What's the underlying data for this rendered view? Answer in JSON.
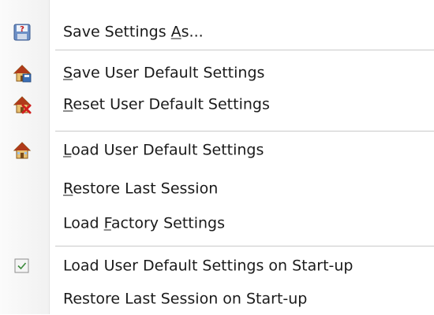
{
  "menu": {
    "items": [
      {
        "before": "Save Settings ",
        "key": "A",
        "after": "s...",
        "icon": "save-as-question-icon",
        "checked": false
      },
      {
        "before": "",
        "key": "S",
        "after": "ave User Default Settings",
        "icon": "house-save-icon",
        "checked": false
      },
      {
        "before": "",
        "key": "R",
        "after": "eset User Default Settings",
        "icon": "house-reset-icon",
        "checked": false
      },
      {
        "before": "",
        "key": "L",
        "after": "oad User Default Settings",
        "icon": "house-load-icon",
        "checked": false
      },
      {
        "before": "",
        "key": "R",
        "after": "estore Last Session",
        "icon": "",
        "checked": false
      },
      {
        "before": "Load ",
        "key": "F",
        "after": "actory Settings",
        "icon": "",
        "checked": false
      },
      {
        "before": "Load User Default Settings on Start-up",
        "key": "",
        "after": "",
        "icon": "checkbox-icon",
        "checked": true
      },
      {
        "before": "Restore Last Session on Start-up",
        "key": "",
        "after": "",
        "icon": "",
        "checked": false
      }
    ]
  },
  "colors": {
    "house_body": "#e8c070",
    "house_roof": "#b03a1a",
    "reset_x": "#d11f1f",
    "save_accent": "#3b6fb5",
    "check_green": "#3a8a3a"
  }
}
